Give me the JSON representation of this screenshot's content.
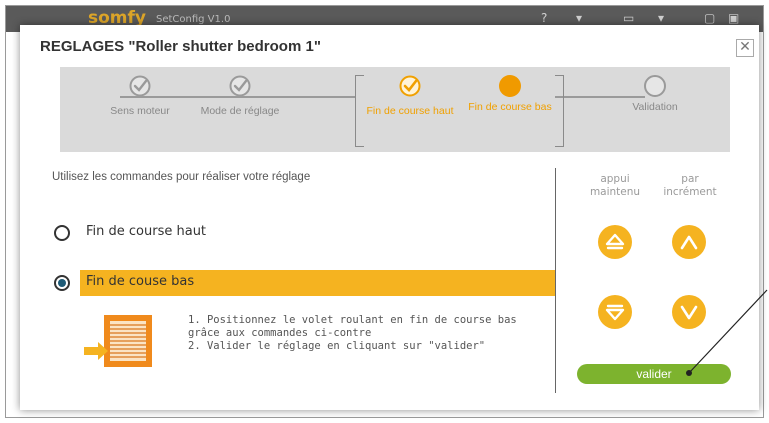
{
  "app": {
    "logo": "somfy",
    "subtitle": "SetConfig V1.0"
  },
  "dialog": {
    "title": "REGLAGES \"Roller shutter bedroom 1\"",
    "close_label": "✕"
  },
  "steps": [
    {
      "label": "Sens moteur",
      "state": "done"
    },
    {
      "label": "Mode de réglage",
      "state": "done"
    },
    {
      "label": "Fin de course haut",
      "state": "done-active"
    },
    {
      "label": "Fin de course bas",
      "state": "current"
    },
    {
      "label": "Validation",
      "state": "pending"
    }
  ],
  "instruction": "Utilisez les commandes pour réaliser votre réglage",
  "options": [
    {
      "label": "Fin de course haut",
      "selected": false
    },
    {
      "label": "Fin de couse bas",
      "selected": true
    }
  ],
  "help": {
    "line1": "1. Positionnez le volet roulant en fin de course bas grâce aux commandes ci-contre",
    "line2": "2. Valider le réglage en cliquant sur \"valider\""
  },
  "controls": {
    "held_header": "appui maintenu",
    "step_header": "par incrément"
  },
  "validate_label": "valider",
  "colors": {
    "accent": "#f5b320",
    "validate": "#7db32e",
    "radio_fill": "#1e5b77"
  }
}
